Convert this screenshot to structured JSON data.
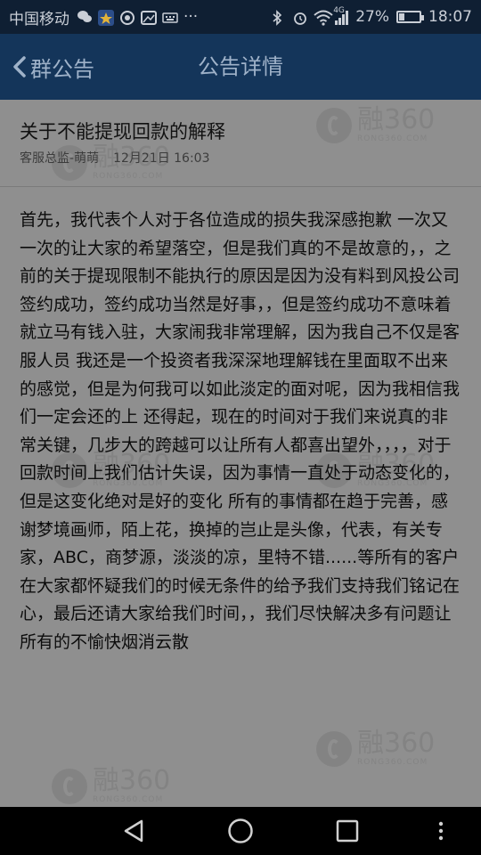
{
  "status_bar": {
    "carrier": "中国移动",
    "signal_type": "4G",
    "battery_level": "27%",
    "battery_fraction": 0.27,
    "time": "18:07",
    "more": "···"
  },
  "header": {
    "back_label": "群公告",
    "title": "公告详情"
  },
  "announcement": {
    "title": "关于不能提现回款的解释",
    "author": "客服总监-萌萌",
    "timestamp": "12月21日 16:03",
    "body": "首先，我代表个人对于各位造成的损失我深感抱歉 一次又一次的让大家的希望落空，但是我们真的不是故意的，，之前的关于提现限制不能执行的原因是因为没有料到风投公司签约成功，签约成功当然是好事，，但是签约成功不意味着就立马有钱入驻，大家闹我非常理解，因为我自己不仅是客服人员 我还是一个投资者我深深地理解钱在里面取不出来的感觉，但是为何我可以如此淡定的面对呢，因为我相信我们一定会还的上 还得起，现在的时间对于我们来说真的非常关键，几步大的跨越可以让所有人都喜出望外，，，，对于回款时间上我们估计失误，因为事情一直处于动态变化的，但是这变化绝对是好的变化 所有的事情都在趋于完善，感谢梦境画师，陌上花，换掉的岂止是头像，代表，有关专家，ABC，商梦源，淡淡的凉，里特不错......等所有的客户在大家都怀疑我们的时候无条件的给予我们支持我们铭记在心，最后还请大家给我们时间，，我们尽快解决多有问题让所有的不愉快烟消云散"
  },
  "watermark": {
    "brand": "融360",
    "sub": "RONG360.COM"
  },
  "colors": {
    "status_bar_bg": "#0f1f33",
    "header_bg": "#14355a",
    "header_text": "#9fb2c9",
    "content_bg": "#8f8f8f",
    "nav_bg": "#000000"
  }
}
